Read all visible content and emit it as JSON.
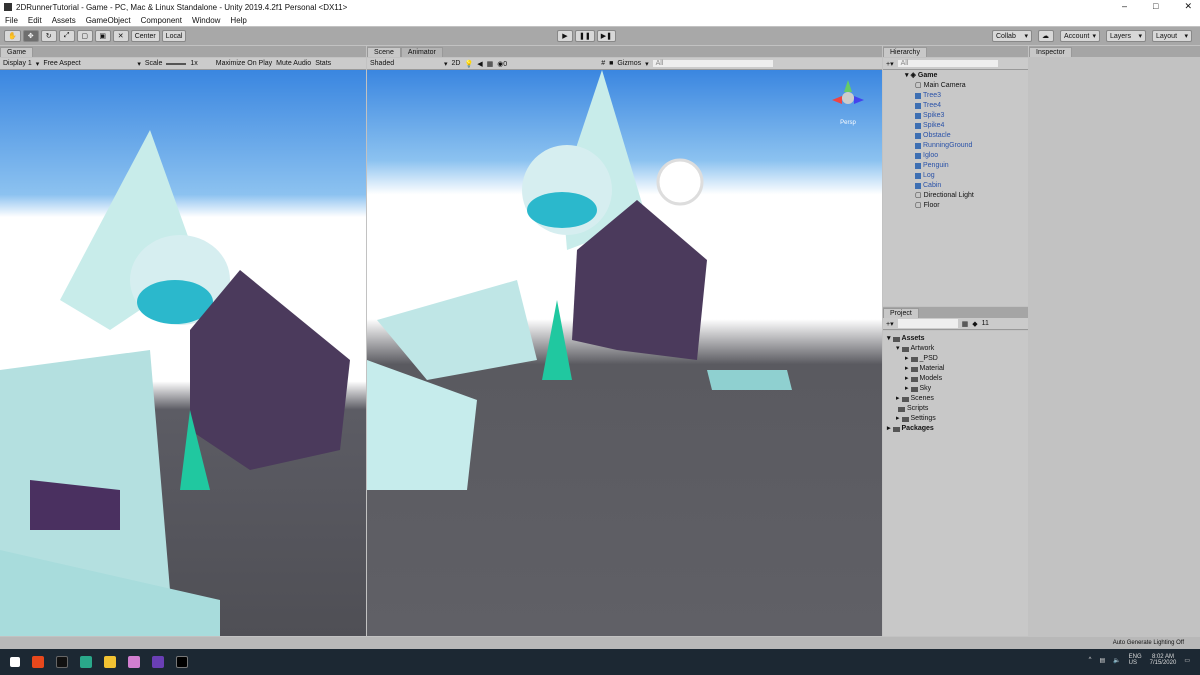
{
  "window": {
    "title": "2DRunnerTutorial - Game - PC, Mac & Linux Standalone - Unity 2019.4.2f1 Personal <DX11>"
  },
  "menu": [
    "File",
    "Edit",
    "Assets",
    "GameObject",
    "Component",
    "Window",
    "Help"
  ],
  "toolbar": {
    "center": "Center",
    "local": "Local",
    "collab": "Collab",
    "account": "Account",
    "layers": "Layers",
    "layout": "Layout"
  },
  "game": {
    "tab": "Game",
    "display": "Display 1",
    "aspect": "Free Aspect",
    "scale_label": "Scale",
    "scale_value": "1x",
    "maximize": "Maximize On Play",
    "mute": "Mute Audio",
    "stats": "Stats"
  },
  "scene": {
    "tab": "Scene",
    "tab2": "Animator",
    "shading": "Shaded",
    "mode": "2D",
    "gizmos": "Gizmos",
    "search": "All",
    "persp": "Persp"
  },
  "hierarchy": {
    "tab": "Hierarchy",
    "search": "All",
    "root": "Game",
    "items": [
      {
        "name": "Main Camera",
        "prefab": false
      },
      {
        "name": "Tree3",
        "prefab": true
      },
      {
        "name": "Tree4",
        "prefab": true
      },
      {
        "name": "Spike3",
        "prefab": true
      },
      {
        "name": "Spike4",
        "prefab": true
      },
      {
        "name": "Obstacle",
        "prefab": true
      },
      {
        "name": "RunningGround",
        "prefab": true
      },
      {
        "name": "Igloo",
        "prefab": true
      },
      {
        "name": "Penguin",
        "prefab": true
      },
      {
        "name": "Log",
        "prefab": true
      },
      {
        "name": "Cabin",
        "prefab": true
      },
      {
        "name": "Directional Light",
        "prefab": false
      },
      {
        "name": "Floor",
        "prefab": false
      }
    ]
  },
  "inspector": {
    "tab": "Inspector"
  },
  "project": {
    "tab": "Project",
    "count": "11",
    "items": [
      {
        "name": "Assets",
        "level": 0
      },
      {
        "name": "Artwork",
        "level": 1
      },
      {
        "name": "_PSD",
        "level": 2
      },
      {
        "name": "Material",
        "level": 2
      },
      {
        "name": "Models",
        "level": 2
      },
      {
        "name": "Sky",
        "level": 2
      },
      {
        "name": "Scenes",
        "level": 1
      },
      {
        "name": "Scripts",
        "level": 1
      },
      {
        "name": "Settings",
        "level": 1
      },
      {
        "name": "Packages",
        "level": 0
      }
    ]
  },
  "status": {
    "text": "Auto Generate Lighting Off"
  },
  "taskbar": {
    "lang": "ENG",
    "region": "US",
    "time": "8:02 AM",
    "date": "7/15/2020"
  }
}
